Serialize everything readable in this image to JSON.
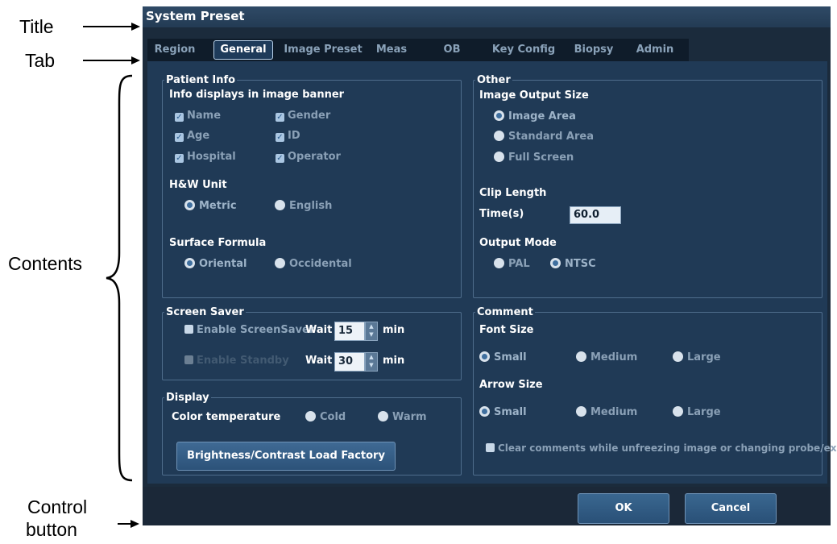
{
  "annotations": {
    "title": "Title",
    "tab": "Tab",
    "contents": "Contents",
    "control_line1": "Control",
    "control_line2": "button"
  },
  "dialog": {
    "title": "System Preset",
    "tabs": [
      "Region",
      "General",
      "Image Preset",
      "Meas",
      "OB",
      "Key Config",
      "Biopsy",
      "Admin"
    ],
    "active_tab": "General"
  },
  "patient_info": {
    "legend": "Patient Info",
    "banner_label": "Info displays in image banner",
    "fields": [
      {
        "label": "Name",
        "checked": true
      },
      {
        "label": "Gender",
        "checked": true
      },
      {
        "label": "Age",
        "checked": true
      },
      {
        "label": "ID",
        "checked": true
      },
      {
        "label": "Hospital",
        "checked": true
      },
      {
        "label": "Operator",
        "checked": true
      }
    ],
    "hw_unit_label": "H&W Unit",
    "hw_options": [
      "Metric",
      "English"
    ],
    "hw_selected": "Metric",
    "surface_formula_label": "Surface Formula",
    "surface_options": [
      "Oriental",
      "Occidental"
    ],
    "surface_selected": "Oriental"
  },
  "other": {
    "legend": "Other",
    "output_size_label": "Image Output Size",
    "output_size_options": [
      "Image Area",
      "Standard Area",
      "Full Screen"
    ],
    "output_size_selected": "Image Area",
    "clip_length_label": "Clip Length",
    "time_label": "Time(s)",
    "time_value": "60.0",
    "output_mode_label": "Output Mode",
    "output_mode_options": [
      "PAL",
      "NTSC"
    ],
    "output_mode_selected": "NTSC"
  },
  "screen_saver": {
    "legend": "Screen Saver",
    "enable_screensaver": "Enable ScreenSaver",
    "enable_standby": "Enable Standby",
    "wait_label": "Wait",
    "wait_value_1": "15",
    "wait_value_2": "30",
    "unit": "min"
  },
  "display": {
    "legend": "Display",
    "color_temp_label": "Color temperature",
    "color_options": [
      "Cold",
      "Warm"
    ],
    "load_factory_button": "Brightness/Contrast Load Factory"
  },
  "comment": {
    "legend": "Comment",
    "font_size_label": "Font Size",
    "font_options": [
      "Small",
      "Medium",
      "Large"
    ],
    "font_selected": "Small",
    "arrow_size_label": "Arrow Size",
    "arrow_options": [
      "Small",
      "Medium",
      "Large"
    ],
    "arrow_selected": "Small",
    "clear_label": "Clear comments while unfreezing image or changing probe/exam"
  },
  "buttons": {
    "ok": "OK",
    "cancel": "Cancel"
  },
  "colors": {
    "panel": "#203a56",
    "title_bar": "#2f4a66",
    "accent_border": "#4f6d8c"
  }
}
